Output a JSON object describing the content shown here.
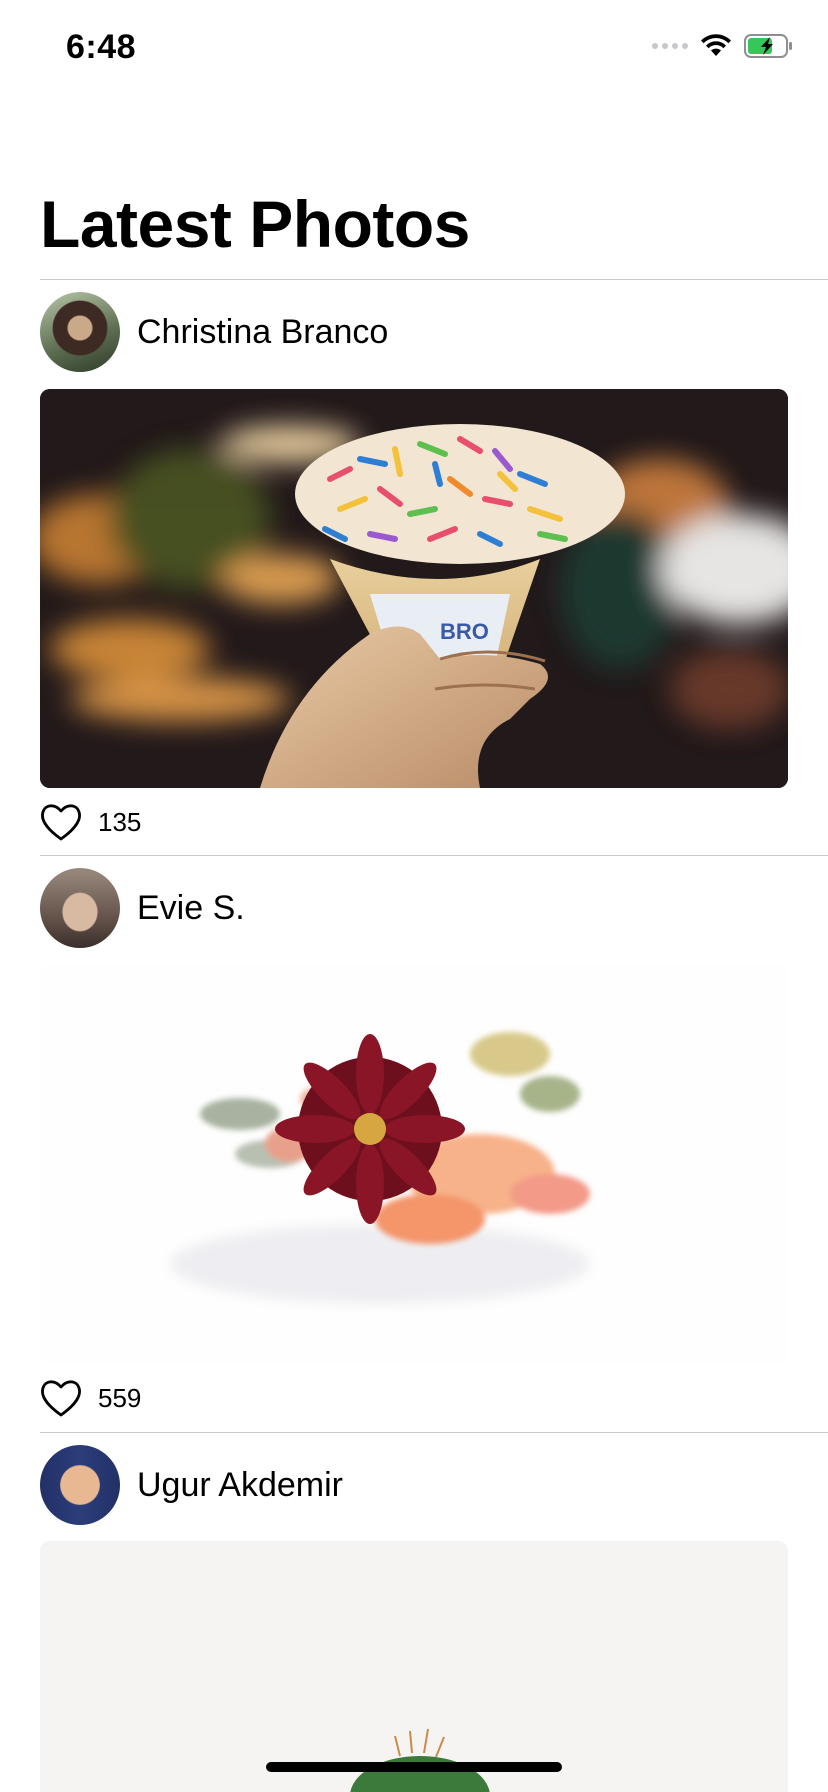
{
  "status_bar": {
    "time": "6:48",
    "icons": [
      "cellular-signal-icon",
      "wifi-icon",
      "battery-charging-icon"
    ],
    "battery_color": "#34c759"
  },
  "title": "Latest Photos",
  "posts": [
    {
      "author": "Christina Branco",
      "likes": "135",
      "photo": "ice-cream-cone-with-sprinkles"
    },
    {
      "author": "Evie S.",
      "likes": "559",
      "photo": "flower-bouquet-on-white"
    },
    {
      "author": "Ugur Akdemir",
      "likes": "",
      "photo": "cactus-on-white"
    }
  ]
}
